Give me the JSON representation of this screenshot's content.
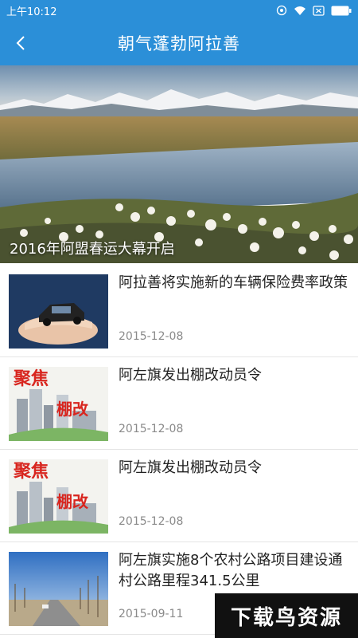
{
  "status_bar": {
    "time": "上午10:12",
    "icons": [
      "alarm-icon",
      "wifi-icon",
      "sim-off-icon",
      "battery-icon"
    ]
  },
  "app_bar": {
    "title": "朝气蓬勃阿拉善",
    "back_icon": "chevron-left-icon"
  },
  "hero": {
    "caption": "2016年阿盟春运大幕开启"
  },
  "news": [
    {
      "title": "阿拉善将实施新的车辆保险费率政策",
      "date": "2015-12-08",
      "thumb": "car-in-hands"
    },
    {
      "title": "阿左旗发出棚改动员令",
      "date": "2015-12-08",
      "thumb": "focus-shed-reform",
      "thumb_text_1": "聚焦",
      "thumb_text_2": "棚改"
    },
    {
      "title": "阿左旗发出棚改动员令",
      "date": "2015-12-08",
      "thumb": "focus-shed-reform",
      "thumb_text_1": "聚焦",
      "thumb_text_2": "棚改"
    },
    {
      "title": "阿左旗实施8个农村公路项目建设通村公路里程341.5公里",
      "date": "2015-09-11",
      "thumb": "rural-road"
    }
  ],
  "watermark": "下载鸟资源",
  "colors": {
    "primary": "#2b8fd8",
    "date_gray": "#8a8a8a"
  }
}
